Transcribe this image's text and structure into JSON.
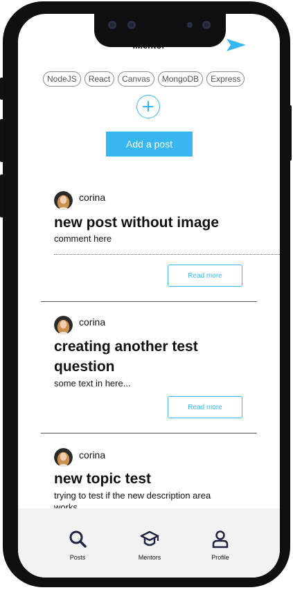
{
  "app": {
    "title": "iMentor"
  },
  "tags": [
    "NodeJS",
    "React",
    "Canvas",
    "MongoDB",
    "Express"
  ],
  "actions": {
    "add_post": "Add a post"
  },
  "posts": [
    {
      "author": "corina",
      "title": "new post without image",
      "description": "comment here",
      "read_more": "Read more"
    },
    {
      "author": "corina",
      "title_line1": "creating another test",
      "title_line2": "question",
      "description": "some text in here...",
      "read_more": "Read more"
    },
    {
      "author": "corina",
      "title": "new topic test",
      "description_line1": "trying to test if the new description area",
      "description_line2": "works"
    }
  ],
  "nav": [
    {
      "label": "Posts",
      "icon": "search-icon"
    },
    {
      "label": "Mentors",
      "icon": "graduation-cap-icon"
    },
    {
      "label": "Profile",
      "icon": "user-icon"
    }
  ],
  "colors": {
    "accent": "#38b6f0",
    "nav_bg": "#f2f2f2",
    "frame": "#0f0f12"
  }
}
